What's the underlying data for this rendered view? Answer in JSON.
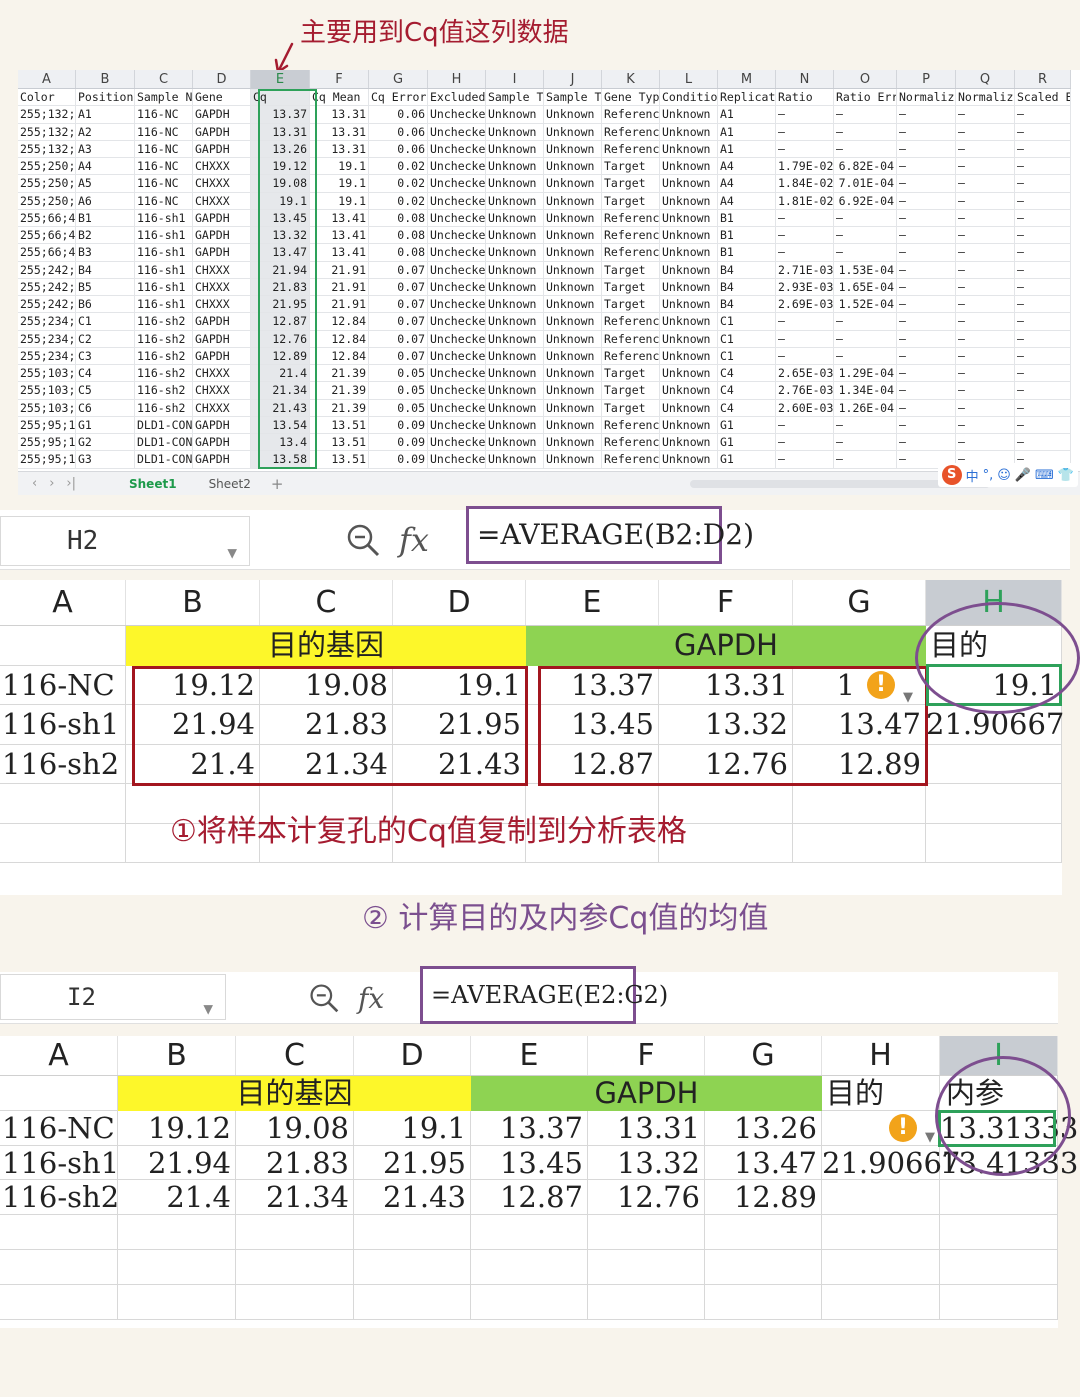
{
  "annotations": {
    "top": "主要用到Cq值这列数据",
    "step1": "①将样本计复孔的Cq值复制到分析表格",
    "step2": "② 计算目的及内参Cq值的均值"
  },
  "top_sheet": {
    "columns": [
      "A",
      "B",
      "C",
      "D",
      "E",
      "F",
      "G",
      "H",
      "I",
      "J",
      "K",
      "L",
      "M",
      "N",
      "O",
      "P",
      "Q",
      "R"
    ],
    "headers": [
      "Color",
      "Position",
      "Sample N",
      "Gene",
      "Cq",
      "Cq Mean",
      "Cq Error",
      "Excluded",
      "Sample T",
      "Sample T",
      "Gene Typ",
      "Conditio",
      "Replicat",
      "Ratio",
      "Ratio Err",
      "Normaliz",
      "Normaliz",
      "Scaled E"
    ],
    "rows": [
      [
        "255;132;",
        "A1",
        "116-NC",
        "GAPDH",
        "13.37",
        "13.31",
        "0.06",
        "Unchecke",
        "Unknown",
        "Unknown",
        "Referenc",
        "Unknown",
        "A1",
        "–",
        "–",
        "–",
        "–",
        "–"
      ],
      [
        "255;132;",
        "A2",
        "116-NC",
        "GAPDH",
        "13.31",
        "13.31",
        "0.06",
        "Unchecke",
        "Unknown",
        "Unknown",
        "Referenc",
        "Unknown",
        "A1",
        "–",
        "–",
        "–",
        "–",
        "–"
      ],
      [
        "255;132;",
        "A3",
        "116-NC",
        "GAPDH",
        "13.26",
        "13.31",
        "0.06",
        "Unchecke",
        "Unknown",
        "Unknown",
        "Referenc",
        "Unknown",
        "A1",
        "–",
        "–",
        "–",
        "–",
        "–"
      ],
      [
        "255;250;",
        "A4",
        "116-NC",
        "CHXXX",
        "19.12",
        "19.1",
        "0.02",
        "Unchecke",
        "Unknown",
        "Unknown",
        "Target",
        "Unknown",
        "A4",
        "1.79E-02",
        "6.82E-04",
        "–",
        "–",
        "–"
      ],
      [
        "255;250;",
        "A5",
        "116-NC",
        "CHXXX",
        "19.08",
        "19.1",
        "0.02",
        "Unchecke",
        "Unknown",
        "Unknown",
        "Target",
        "Unknown",
        "A4",
        "1.84E-02",
        "7.01E-04",
        "–",
        "–",
        "–"
      ],
      [
        "255;250;",
        "A6",
        "116-NC",
        "CHXXX",
        "19.1",
        "19.1",
        "0.02",
        "Unchecke",
        "Unknown",
        "Unknown",
        "Target",
        "Unknown",
        "A4",
        "1.81E-02",
        "6.92E-04",
        "–",
        "–",
        "–"
      ],
      [
        "255;66;4",
        "B1",
        "116-sh1",
        "GAPDH",
        "13.45",
        "13.41",
        "0.08",
        "Unchecke",
        "Unknown",
        "Unknown",
        "Referenc",
        "Unknown",
        "B1",
        "–",
        "–",
        "–",
        "–",
        "–"
      ],
      [
        "255;66;4",
        "B2",
        "116-sh1",
        "GAPDH",
        "13.32",
        "13.41",
        "0.08",
        "Unchecke",
        "Unknown",
        "Unknown",
        "Referenc",
        "Unknown",
        "B1",
        "–",
        "–",
        "–",
        "–",
        "–"
      ],
      [
        "255;66;4",
        "B3",
        "116-sh1",
        "GAPDH",
        "13.47",
        "13.41",
        "0.08",
        "Unchecke",
        "Unknown",
        "Unknown",
        "Referenc",
        "Unknown",
        "B1",
        "–",
        "–",
        "–",
        "–",
        "–"
      ],
      [
        "255;242;",
        "B4",
        "116-sh1",
        "CHXXX",
        "21.94",
        "21.91",
        "0.07",
        "Unchecke",
        "Unknown",
        "Unknown",
        "Target",
        "Unknown",
        "B4",
        "2.71E-03",
        "1.53E-04",
        "–",
        "–",
        "–"
      ],
      [
        "255;242;",
        "B5",
        "116-sh1",
        "CHXXX",
        "21.83",
        "21.91",
        "0.07",
        "Unchecke",
        "Unknown",
        "Unknown",
        "Target",
        "Unknown",
        "B4",
        "2.93E-03",
        "1.65E-04",
        "–",
        "–",
        "–"
      ],
      [
        "255;242;",
        "B6",
        "116-sh1",
        "CHXXX",
        "21.95",
        "21.91",
        "0.07",
        "Unchecke",
        "Unknown",
        "Unknown",
        "Target",
        "Unknown",
        "B4",
        "2.69E-03",
        "1.52E-04",
        "–",
        "–",
        "–"
      ],
      [
        "255;234;",
        "C1",
        "116-sh2",
        "GAPDH",
        "12.87",
        "12.84",
        "0.07",
        "Unchecke",
        "Unknown",
        "Unknown",
        "Referenc",
        "Unknown",
        "C1",
        "–",
        "–",
        "–",
        "–",
        "–"
      ],
      [
        "255;234;",
        "C2",
        "116-sh2",
        "GAPDH",
        "12.76",
        "12.84",
        "0.07",
        "Unchecke",
        "Unknown",
        "Unknown",
        "Referenc",
        "Unknown",
        "C1",
        "–",
        "–",
        "–",
        "–",
        "–"
      ],
      [
        "255;234;",
        "C3",
        "116-sh2",
        "GAPDH",
        "12.89",
        "12.84",
        "0.07",
        "Unchecke",
        "Unknown",
        "Unknown",
        "Referenc",
        "Unknown",
        "C1",
        "–",
        "–",
        "–",
        "–",
        "–"
      ],
      [
        "255;103;",
        "C4",
        "116-sh2",
        "CHXXX",
        "21.4",
        "21.39",
        "0.05",
        "Unchecke",
        "Unknown",
        "Unknown",
        "Target",
        "Unknown",
        "C4",
        "2.65E-03",
        "1.29E-04",
        "–",
        "–",
        "–"
      ],
      [
        "255;103;",
        "C5",
        "116-sh2",
        "CHXXX",
        "21.34",
        "21.39",
        "0.05",
        "Unchecke",
        "Unknown",
        "Unknown",
        "Target",
        "Unknown",
        "C4",
        "2.76E-03",
        "1.34E-04",
        "–",
        "–",
        "–"
      ],
      [
        "255;103;",
        "C6",
        "116-sh2",
        "CHXXX",
        "21.43",
        "21.39",
        "0.05",
        "Unchecke",
        "Unknown",
        "Unknown",
        "Target",
        "Unknown",
        "C4",
        "2.60E-03",
        "1.26E-04",
        "–",
        "–",
        "–"
      ],
      [
        "255;95;1",
        "G1",
        "DLD1-CON",
        "GAPDH",
        "13.54",
        "13.51",
        "0.09",
        "Unchecke",
        "Unknown",
        "Unknown",
        "Referenc",
        "Unknown",
        "G1",
        "–",
        "–",
        "–",
        "–",
        "–"
      ],
      [
        "255;95;1",
        "G2",
        "DLD1-CON",
        "GAPDH",
        "13.4",
        "13.51",
        "0.09",
        "Unchecke",
        "Unknown",
        "Unknown",
        "Referenc",
        "Unknown",
        "G1",
        "–",
        "–",
        "–",
        "–",
        "–"
      ],
      [
        "255;95;1",
        "G3",
        "DLD1-CON",
        "GAPDH",
        "13.58",
        "13.51",
        "0.09",
        "Unchecke",
        "Unknown",
        "Unknown",
        "Referenc",
        "Unknown",
        "G1",
        "–",
        "–",
        "–",
        "–",
        "–"
      ]
    ],
    "tabs": [
      "Sheet1",
      "Sheet2"
    ],
    "add_tab": "+",
    "ime": [
      "S",
      "中",
      "°,",
      "☺",
      "🎤",
      "⌨",
      "👕"
    ]
  },
  "panel1": {
    "cell_ref": "H2",
    "formula": "=AVERAGE(B2:D2)",
    "columns": [
      "A",
      "B",
      "C",
      "D",
      "E",
      "F",
      "G",
      "H"
    ],
    "band_target": "目的基因",
    "band_ref": "GAPDH",
    "h_header": "目的",
    "rows": [
      [
        "116-NC",
        "19.12",
        "19.08",
        "19.1",
        "13.37",
        "13.31",
        "1",
        "19.1"
      ],
      [
        "116-sh1",
        "21.94",
        "21.83",
        "21.95",
        "13.45",
        "13.32",
        "13.47",
        "21.90667"
      ],
      [
        "116-sh2",
        "21.4",
        "21.34",
        "21.43",
        "12.87",
        "12.76",
        "12.89",
        ""
      ]
    ]
  },
  "panel2": {
    "cell_ref": "I2",
    "formula": "=AVERAGE(E2:G2)",
    "columns": [
      "A",
      "B",
      "C",
      "D",
      "E",
      "F",
      "G",
      "H",
      "I"
    ],
    "band_target": "目的基因",
    "band_ref": "GAPDH",
    "h_header": "目的",
    "i_header": "内参",
    "rows": [
      [
        "116-NC",
        "19.12",
        "19.08",
        "19.1",
        "13.37",
        "13.31",
        "13.26",
        "",
        "13.31333"
      ],
      [
        "116-sh1",
        "21.94",
        "21.83",
        "21.95",
        "13.45",
        "13.32",
        "13.47",
        "21.90667",
        "13.41333"
      ],
      [
        "116-sh2",
        "21.4",
        "21.34",
        "21.43",
        "12.87",
        "12.76",
        "12.89",
        "",
        ""
      ]
    ]
  },
  "colors": {
    "annotation_red": "#a51c30",
    "annotation_purple": "#7d4e8f",
    "band_yellow": "#fdf72a",
    "band_green": "#8ed352",
    "select_green": "#2ea15a"
  }
}
